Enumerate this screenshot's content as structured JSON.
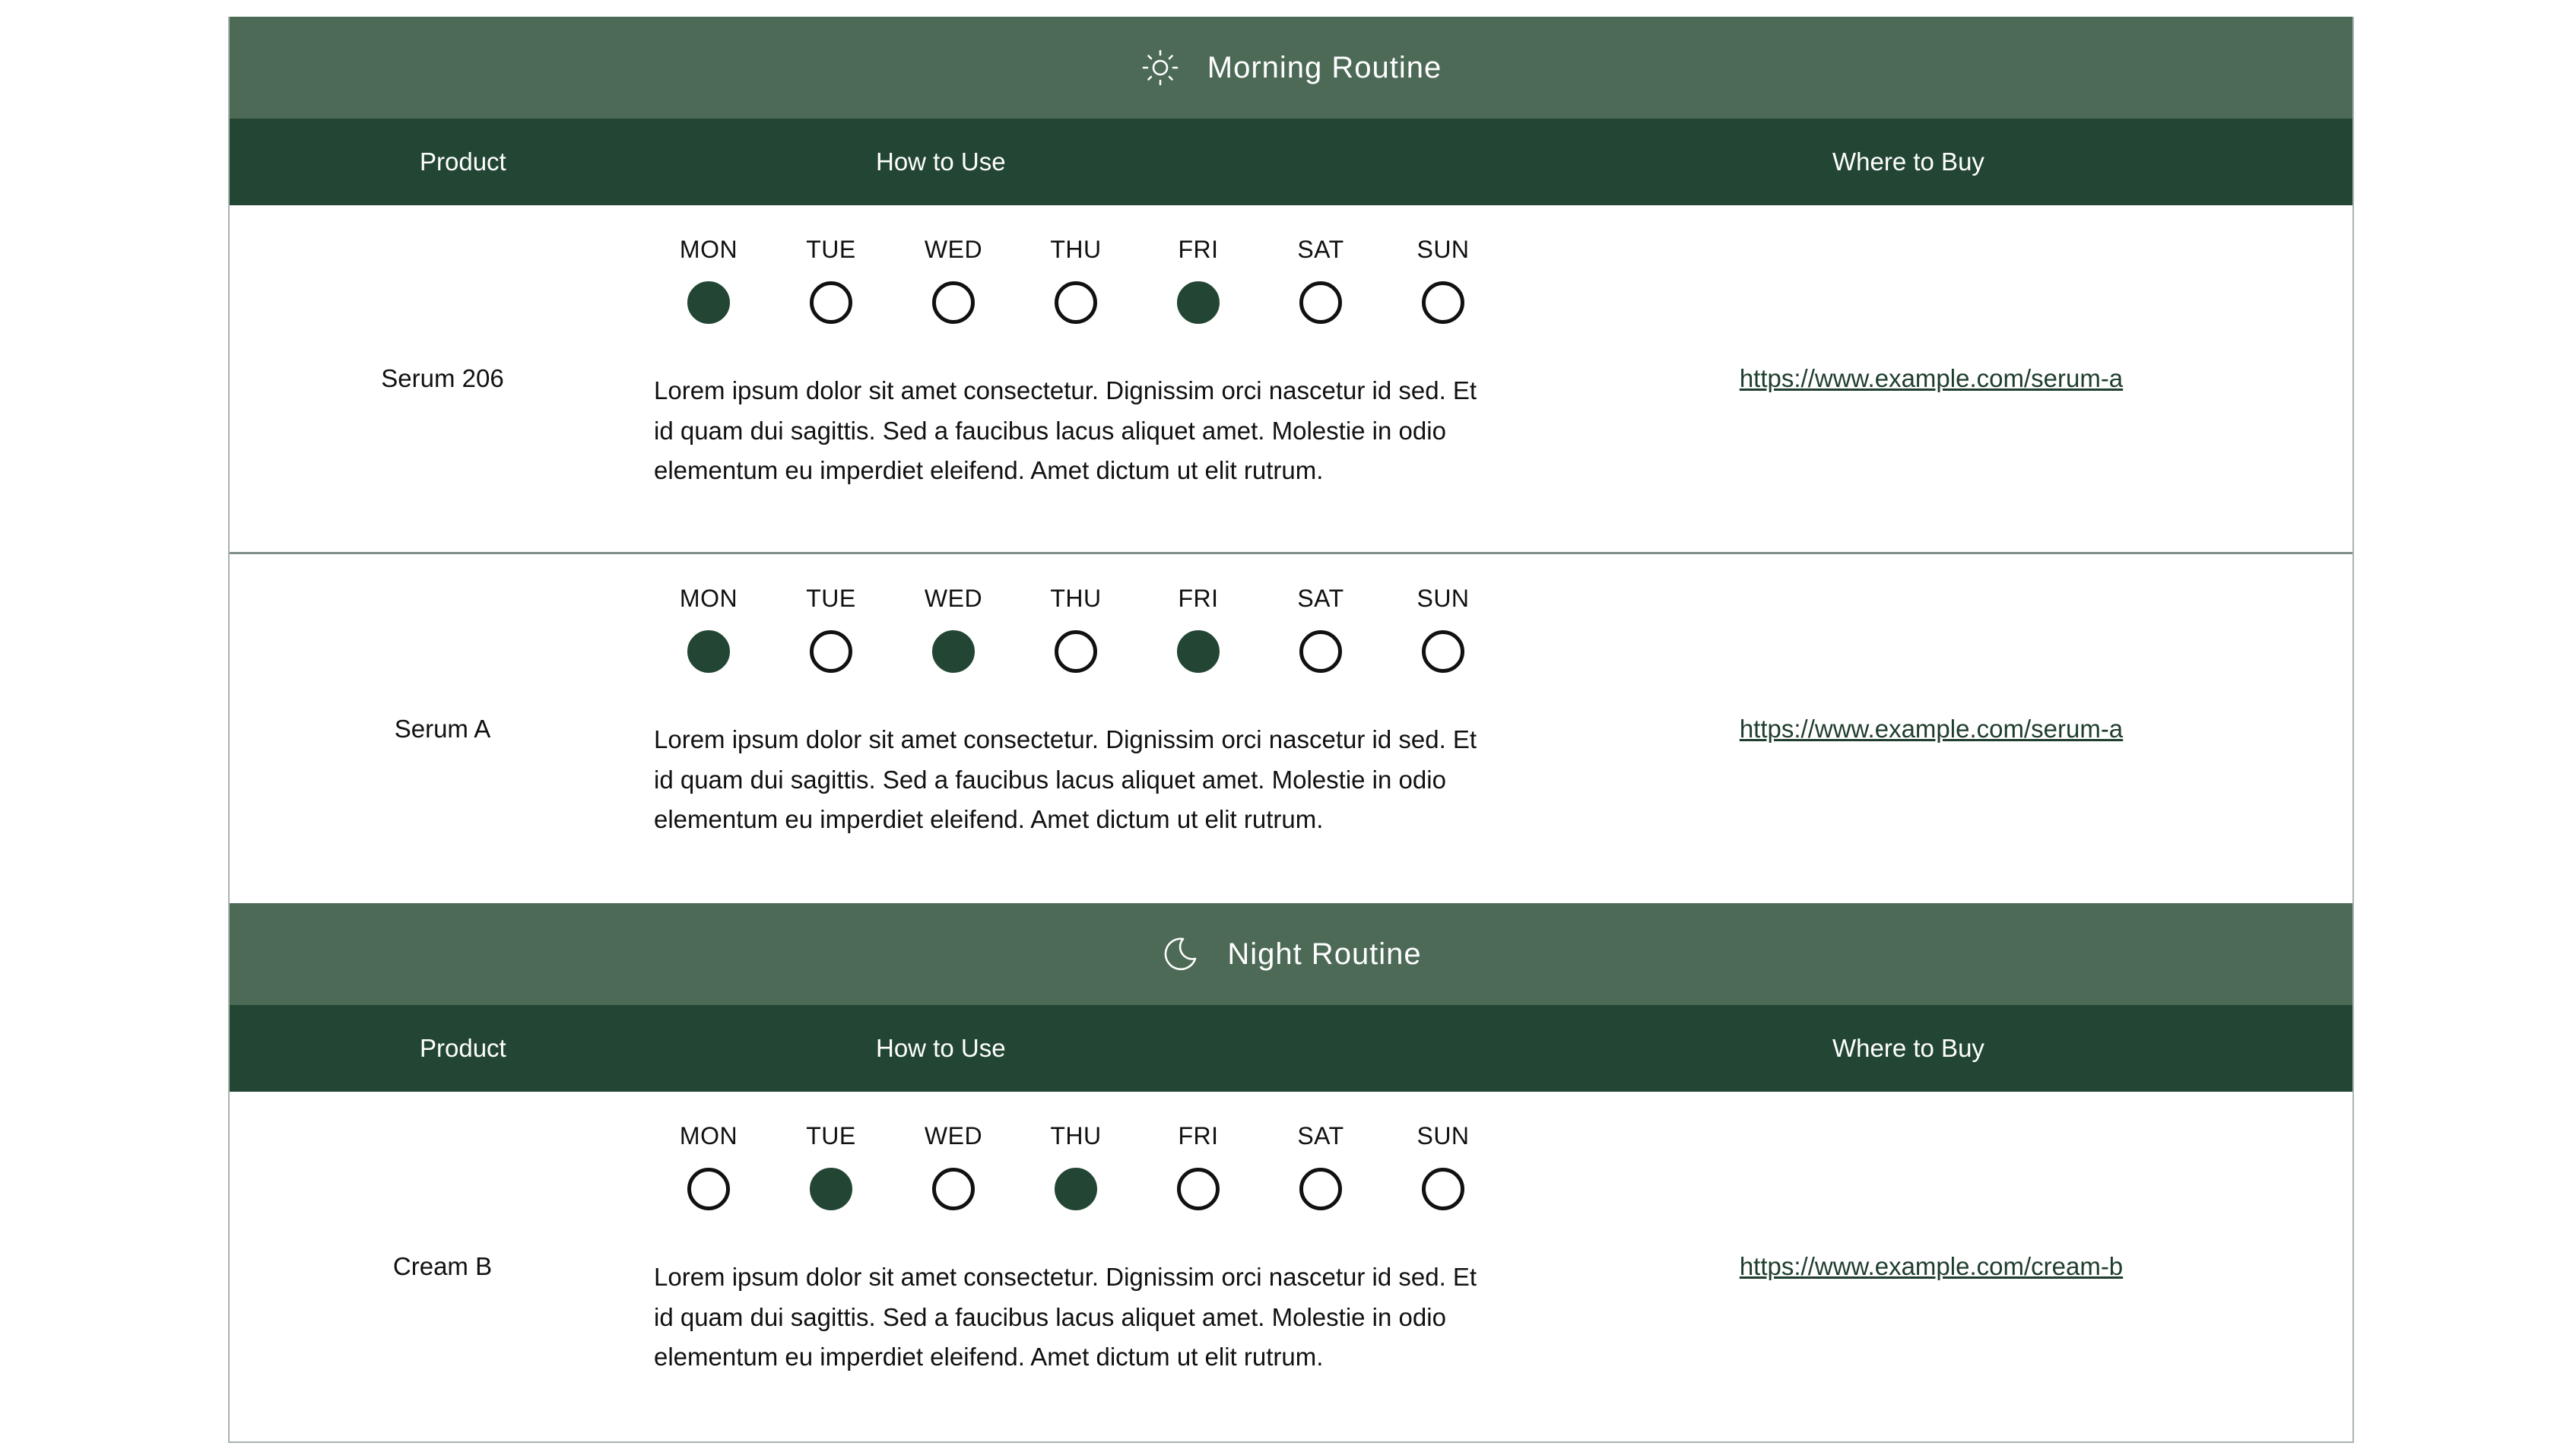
{
  "colors": {
    "section_header": "#4d6a57",
    "column_header": "#234634",
    "dot_filled": "#234634"
  },
  "day_labels": [
    "MON",
    "TUE",
    "WED",
    "THU",
    "FRI",
    "SAT",
    "SUN"
  ],
  "columns": {
    "product": "Product",
    "how": "How to Use",
    "where": "Where to Buy"
  },
  "sections": [
    {
      "title": "Morning Routine",
      "icon": "sun-icon",
      "rows": [
        {
          "product": "Serum 206",
          "days": [
            true,
            false,
            false,
            false,
            true,
            false,
            false
          ],
          "description": "Lorem ipsum dolor sit amet consectetur. Dignissim orci nascetur id sed. Et id quam dui sagittis. Sed a faucibus lacus aliquet amet. Molestie in odio elementum eu imperdiet eleifend. Amet dictum ut elit rutrum.",
          "link": "https://www.example.com/serum-a"
        },
        {
          "product": "Serum A",
          "days": [
            true,
            false,
            true,
            false,
            true,
            false,
            false
          ],
          "description": "Lorem ipsum dolor sit amet consectetur. Dignissim orci nascetur id sed. Et id quam dui sagittis. Sed a faucibus lacus aliquet amet. Molestie in odio elementum eu imperdiet eleifend. Amet dictum ut elit rutrum.",
          "link": "https://www.example.com/serum-a"
        }
      ]
    },
    {
      "title": "Night Routine",
      "icon": "moon-icon",
      "rows": [
        {
          "product": "Cream B",
          "days": [
            false,
            true,
            false,
            true,
            false,
            false,
            false
          ],
          "description": "Lorem ipsum dolor sit amet consectetur. Dignissim orci nascetur id sed. Et id quam dui sagittis. Sed a faucibus lacus aliquet amet. Molestie in odio elementum eu imperdiet eleifend. Amet dictum ut elit rutrum.",
          "link": "https://www.example.com/cream-b"
        }
      ]
    }
  ]
}
